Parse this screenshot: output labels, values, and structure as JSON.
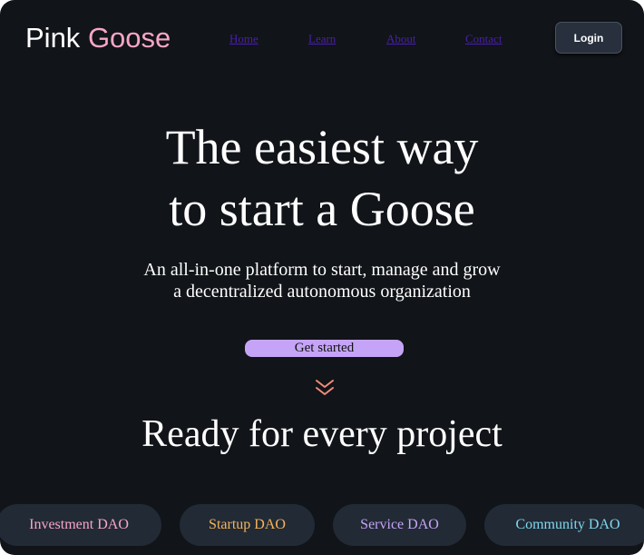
{
  "brand": {
    "word1": "Pink",
    "word2": "Goose",
    "accent_color": "#f7a6c7"
  },
  "nav": {
    "links": [
      {
        "label": "Home"
      },
      {
        "label": "Learn"
      },
      {
        "label": "About"
      },
      {
        "label": "Contact"
      }
    ],
    "login_label": "Login"
  },
  "hero": {
    "title_line1": "The easiest way",
    "title_line2": "to start a Goose",
    "subtitle_line1": "An all-in-one platform to start, manage and grow",
    "subtitle_line2": "a decentralized autonomous organization",
    "cta_label": "Get started",
    "cta_color": "#c5a4f7",
    "scroll_icon": "double-chevron-down-icon",
    "scroll_icon_color": "#f08b7a"
  },
  "projects": {
    "title": "Ready for every project",
    "types": [
      {
        "label": "Investment DAO",
        "color": "#f7a6c7"
      },
      {
        "label": "Startup DAO",
        "color": "#f5b45a"
      },
      {
        "label": "Service DAO",
        "color": "#c5a4f7"
      },
      {
        "label": "Community DAO",
        "color": "#7fd8f0"
      }
    ]
  }
}
